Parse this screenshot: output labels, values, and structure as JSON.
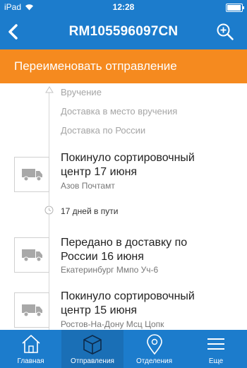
{
  "status_bar": {
    "device": "iPad",
    "time": "12:28"
  },
  "nav": {
    "title": "RM105596097CN",
    "back_icon": "chevron-left-icon",
    "zoom_icon": "zoom-in-icon"
  },
  "banner": {
    "label": "Переименовать отправление"
  },
  "future_steps": [
    {
      "label": "Вручение"
    },
    {
      "label": "Доставка в место вручения"
    },
    {
      "label": "Доставка по России"
    }
  ],
  "events": [
    {
      "title_line1": "Покинуло сортировочный",
      "title_line2": "центр 17 июня",
      "place": "Азов Почтамт",
      "icon": "truck-icon"
    },
    {
      "title_line1": "Передано в доставку по",
      "title_line2": "России 16 июня",
      "place": "Екатеринбург Ммпо Уч-6",
      "icon": "truck-icon"
    },
    {
      "title_line1": "Покинуло сортировочный",
      "title_line2": "центр 15 июня",
      "place": "Ростов-На-Дону Мсц Цопк",
      "icon": "truck-icon"
    }
  ],
  "transit": {
    "label": "17 дней в пути",
    "icon": "clock-icon"
  },
  "tabs": [
    {
      "label": "Главная",
      "icon": "home-icon",
      "active": false
    },
    {
      "label": "Отправления",
      "icon": "parcel-icon",
      "active": true
    },
    {
      "label": "Отделения",
      "icon": "map-pin-icon",
      "active": false
    },
    {
      "label": "Еще",
      "icon": "menu-icon",
      "active": false
    }
  ],
  "colors": {
    "primary": "#1c7ccc",
    "accent": "#f58a1f",
    "muted_text": "#a5a5a5"
  }
}
